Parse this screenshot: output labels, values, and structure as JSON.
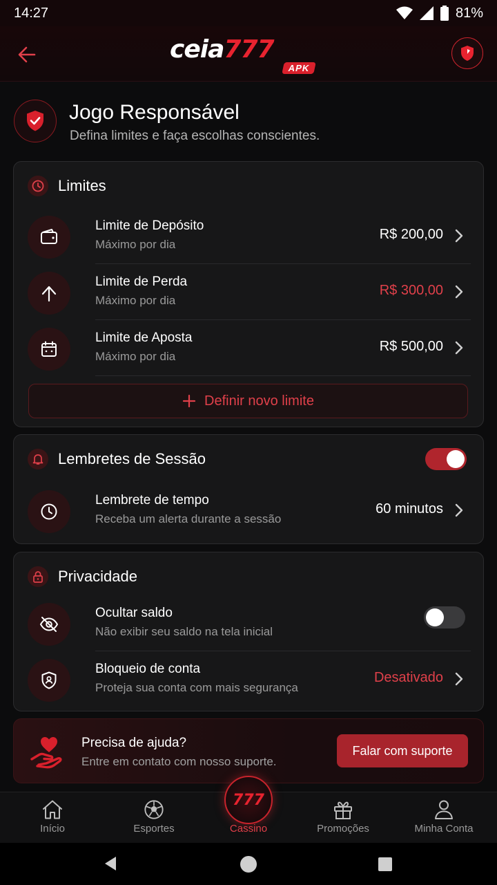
{
  "status": {
    "time": "14:27",
    "battery": "81%"
  },
  "header": {
    "logo_main": "ceia",
    "logo_num": "777",
    "logo_badge": "APK"
  },
  "page": {
    "title": "Jogo Responsável",
    "subtitle": "Defina limites e faça escolhas conscientes."
  },
  "limits": {
    "title": "Limites",
    "items": [
      {
        "label": "Limite de Depósito",
        "sub": "Máximo por dia",
        "value": "R$ 200,00"
      },
      {
        "label": "Limite de Perda",
        "sub": "Máximo por dia",
        "value": "R$ 300,00"
      },
      {
        "label": "Limite de Aposta",
        "sub": "Máximo por dia",
        "value": "R$ 500,00"
      }
    ],
    "add_label": "Definir novo limite"
  },
  "session": {
    "title": "Lembretes de Sessão",
    "toggle_on": true,
    "item": {
      "label": "Lembrete de tempo",
      "sub": "Receba um alerta durante a sessão",
      "value": "60 minutos"
    }
  },
  "privacy": {
    "title": "Privacidade",
    "items": [
      {
        "label": "Ocultar saldo",
        "sub": "Não exibir seu saldo na tela inicial",
        "toggle_on": false
      },
      {
        "label": "Bloqueio de conta",
        "sub": "Proteja sua conta com mais segurança",
        "value": "Desativado"
      }
    ]
  },
  "help": {
    "title": "Precisa de ajuda?",
    "sub": "Entre em contato com nosso suporte.",
    "button": "Falar com suporte"
  },
  "nav": {
    "items": [
      "Início",
      "Esportes",
      "Cassino",
      "Promoções",
      "Minha Conta"
    ],
    "center_label": "777",
    "active": "Cassino"
  },
  "colors": {
    "accent": "#e0404a",
    "brand": "#c8232c",
    "background": "#0c0c0d",
    "card": "#171718"
  }
}
